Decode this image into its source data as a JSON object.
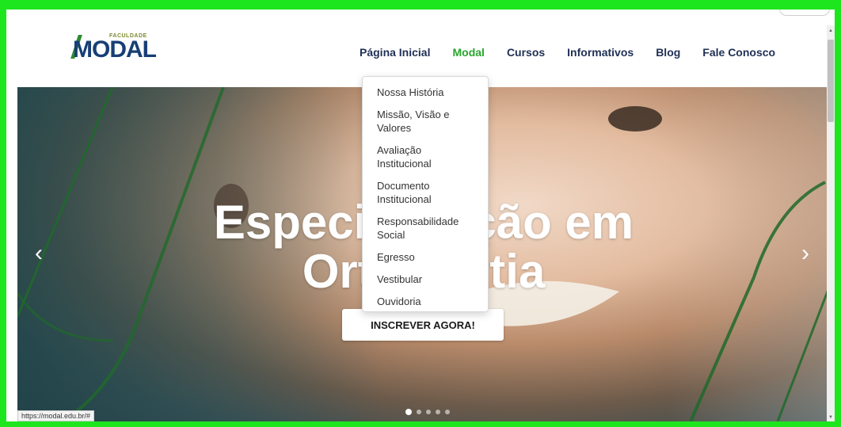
{
  "logo": {
    "small": "FACULDADE",
    "word": "MODAL"
  },
  "nav": {
    "items": [
      {
        "label": "Página Inicial"
      },
      {
        "label": "Modal"
      },
      {
        "label": "Cursos"
      },
      {
        "label": "Informativos"
      },
      {
        "label": "Blog"
      },
      {
        "label": "Fale Conosco"
      }
    ],
    "active": "Modal"
  },
  "dropdown": {
    "items": [
      "Nossa História",
      "Missão, Visão e Valores",
      "Avaliação Institucional",
      "Documento Institucional",
      "Responsabilidade Social",
      "Egresso",
      "Vestibular",
      "Ouvidoria"
    ]
  },
  "hero": {
    "title_line1": "Especialização em",
    "title_line2": "Ortodontia",
    "cta": "INSCREVER AGORA!",
    "prev": "‹",
    "next": "›",
    "slides_count": 5,
    "active_slide": 1
  },
  "status_url": "https://modal.edu.br/#",
  "colors": {
    "nav_text": "#1f2f55",
    "accent": "#29a52d",
    "frame": "#1ee61e"
  }
}
